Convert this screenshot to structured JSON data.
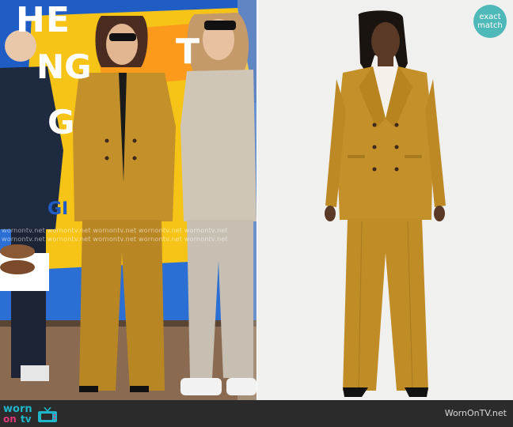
{
  "left_panel": {
    "show_title_letters": [
      "HE",
      "NG",
      "T",
      "G",
      "GI"
    ],
    "watermark_rows": [
      "wornontv.net  wornontv.net  wornontv.net  wornontv.net  wornontv.net",
      "wornontv.net  wornontv.net  wornontv.net  wornontv.net  wornontv.net"
    ]
  },
  "right_panel": {
    "badge_line1": "exact",
    "badge_line2": "match"
  },
  "footer": {
    "logo_worn": "worn",
    "logo_on": "on",
    "logo_tv": "tv",
    "site_name": "WornOnTV.net"
  },
  "colors": {
    "suit_mustard": "#c4902a",
    "beige_suit": "#cfc6b8",
    "set_blue": "#2c6fd4",
    "set_yellow": "#f6c416",
    "badge_teal": "#4fb8b8",
    "footer_bg": "#2b2b2b"
  }
}
